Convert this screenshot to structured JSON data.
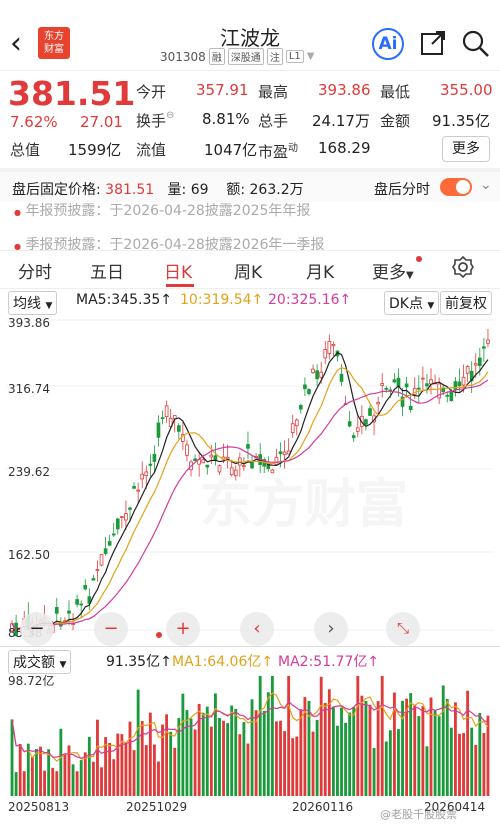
{
  "header": {
    "title": "江波龙",
    "code": "301308",
    "tags": [
      "融",
      "深股通",
      "注",
      "L1"
    ],
    "logo_text": [
      "东方",
      "财富"
    ],
    "ai_label": "Ai"
  },
  "quote": {
    "price": "381.51",
    "change_pct": "7.62%",
    "change_abs": "27.01",
    "open_label": "今开",
    "open": "357.91",
    "high_label": "最高",
    "high": "393.86",
    "low_label": "最低",
    "low": "355.00",
    "turnover_label": "换手",
    "turnover": "8.81%",
    "volume_label": "总手",
    "volume": "24.17万",
    "amount_label": "金额",
    "amount": "91.35亿",
    "mcap_label": "总值",
    "mcap": "1599亿",
    "float_label": "流值",
    "float": "1047亿",
    "pe_label": "市盈",
    "pe_sup": "动",
    "pe": "168.29",
    "more_label": "更多"
  },
  "after_hours": {
    "label": "盘后固定价格:",
    "price": "381.51",
    "vol_label": "量:",
    "vol": "69",
    "amt_label": "额:",
    "amt": "263.2万",
    "toggle_label": "盘后分时"
  },
  "news": [
    "年报预披露：于2026-04-28披露2025年年报",
    "季报预披露：于2026-04-28披露2026年一季报"
  ],
  "tabs": [
    "分时",
    "五日",
    "日K",
    "周K",
    "月K",
    "更多"
  ],
  "active_tab": "日K",
  "kchart": {
    "ma_select": "均线",
    "ma5": "MA5:345.35↑",
    "ma10": "10:319.54↑",
    "ma20": "20:325.16↑",
    "dk_label": "DK点",
    "adjust_label": "前复权",
    "y_ticks": [
      "393.86",
      "316.74",
      "239.62",
      "162.50",
      "85.38"
    ],
    "colors": {
      "up": "#e03a3a",
      "down": "#1a9a3a",
      "ma5": "#222222",
      "ma10": "#e3a21a",
      "ma20": "#d63a9a"
    }
  },
  "volume": {
    "select": "成交额",
    "total": "91.35亿↑",
    "ma1": "MA1:64.06亿↑",
    "ma2": "MA2:51.77亿↑",
    "max_label": "98.72亿"
  },
  "dates": [
    "20250813",
    "20251029",
    "20260116",
    "20260414"
  ],
  "watermark": "@老股千股股票"
}
